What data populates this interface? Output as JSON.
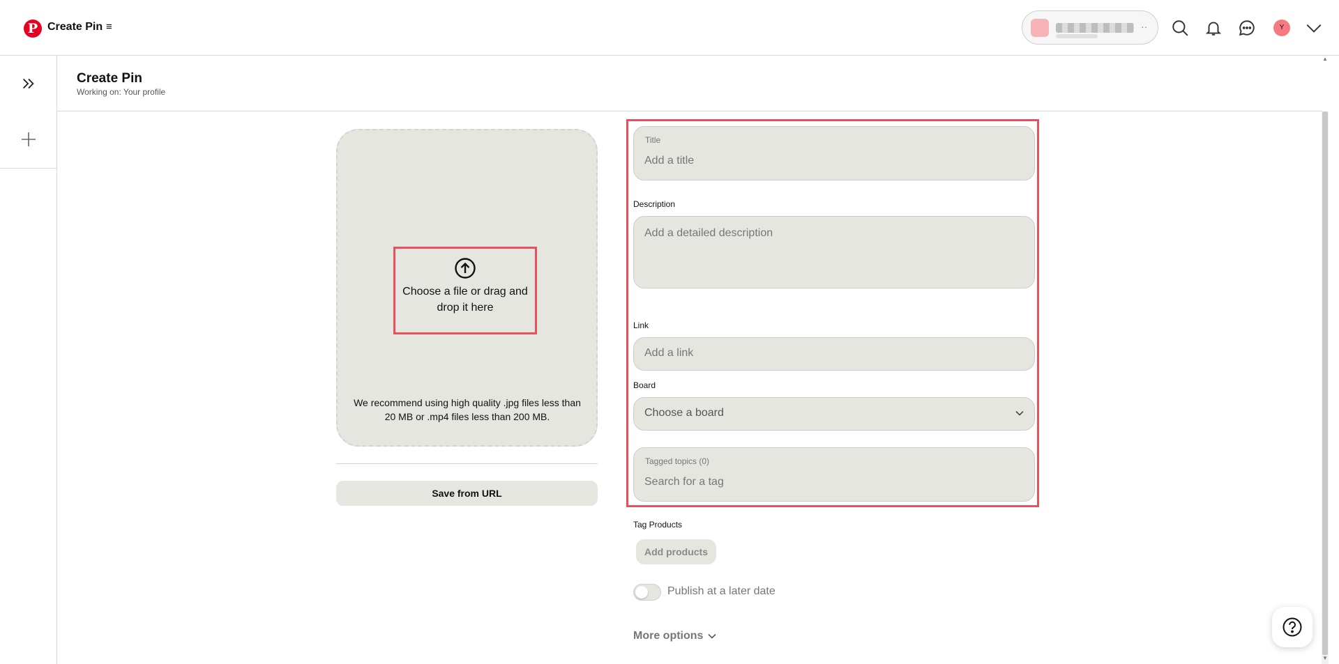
{
  "app": {
    "logo_letter": "P",
    "title": "Create Pin"
  },
  "header": {
    "account": {
      "name_blurred": "",
      "icon": "account-switcher"
    },
    "icons": [
      "search-icon",
      "bell-icon",
      "messages-icon",
      "avatar",
      "chevron-down-icon"
    ],
    "avatar_initial": "Y"
  },
  "page": {
    "title": "Create Pin",
    "subtitle": "Working on: Your profile"
  },
  "upload": {
    "prompt": "Choose a file or drag and drop it here",
    "note": "We recommend using high quality .jpg files less than 20 MB or .mp4 files less than 200 MB.",
    "save_from_url": "Save from URL"
  },
  "form": {
    "title": {
      "label": "Title",
      "placeholder": "Add a title",
      "value": ""
    },
    "description": {
      "label": "Description",
      "placeholder": "Add a detailed description",
      "value": ""
    },
    "link": {
      "label": "Link",
      "placeholder": "Add a link",
      "value": ""
    },
    "board": {
      "label": "Board",
      "selected": "Choose a board"
    },
    "tagged_topics": {
      "label": "Tagged topics (0)",
      "placeholder": "Search for a tag",
      "value": ""
    },
    "tag_products": {
      "label": "Tag Products",
      "button": "Add products"
    },
    "publish_later": {
      "label": "Publish at a later date",
      "enabled": false
    },
    "more_options": "More options"
  },
  "colors": {
    "brand": "#e60023",
    "highlight": "#e8505b",
    "field_bg": "#e6e6e1"
  }
}
